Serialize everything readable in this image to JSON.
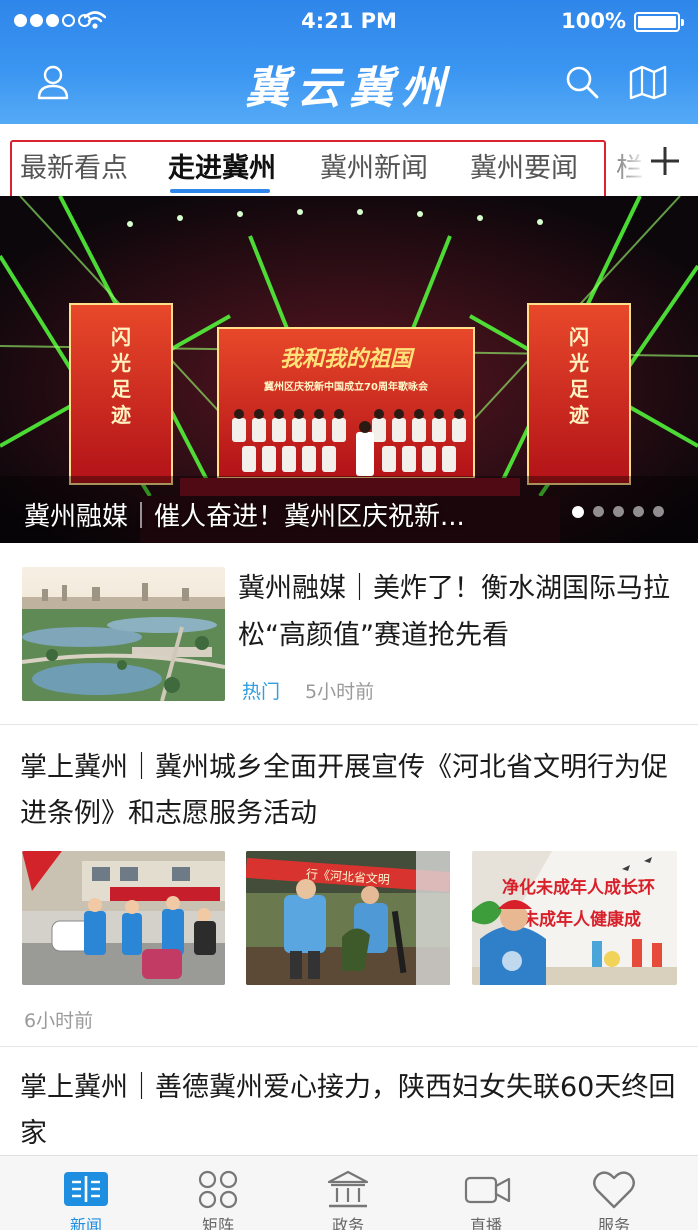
{
  "status_bar": {
    "time": "4:21 PM",
    "battery": "100%",
    "signal_bars_filled": 3,
    "signal_bars_total": 5
  },
  "header": {
    "title": "冀云冀州",
    "left_icon": "user-icon",
    "right_icons": [
      "search-icon",
      "map-icon"
    ]
  },
  "tabs": {
    "items": [
      {
        "label": "最新看点",
        "active": false
      },
      {
        "label": "走进冀州",
        "active": true
      },
      {
        "label": "冀州新闻",
        "active": false
      },
      {
        "label": "冀州要闻",
        "active": false
      }
    ],
    "overflow_label": "栏",
    "add_icon": "plus-icon"
  },
  "hero": {
    "caption": "冀州融媒｜催人奋进！冀州区庆祝新...",
    "slide_count": 5,
    "active_slide": 1,
    "stage": {
      "banner_main": "我和我的祖国",
      "banner_sub": "冀州区庆祝新中国成立70周年歌咏会",
      "side_banner": "闪光足迹"
    }
  },
  "news": [
    {
      "title": "冀州融媒｜美炸了！衡水湖国际马拉松“高颜值”赛道抢先看",
      "tag": "热门",
      "time": "5小时前"
    },
    {
      "title": "掌上冀州｜冀州城乡全面开展宣传《河北省文明行为促进条例》和志愿服务活动",
      "time": "6小时前",
      "images": {
        "b_banner": "行《河北省文明",
        "c_banner_1": "净化未成年人成长环",
        "c_banner_2": "未成年人健康成"
      }
    },
    {
      "title": "掌上冀州｜善德冀州爱心接力，陕西妇女失联60天终回家"
    }
  ],
  "bottom_nav": [
    {
      "label": "新闻",
      "icon": "book-icon",
      "active": true
    },
    {
      "label": "矩阵",
      "icon": "matrix-icon",
      "active": false
    },
    {
      "label": "政务",
      "icon": "government-icon",
      "active": false
    },
    {
      "label": "直播",
      "icon": "video-camera-icon",
      "active": false
    },
    {
      "label": "服务",
      "icon": "heart-icon",
      "active": false
    }
  ],
  "colors": {
    "header_blue": "#3a95f1",
    "accent_blue": "#1e8fe0",
    "tab_outline_red": "#d9232e",
    "hot_tag": "#2f9ee0"
  }
}
